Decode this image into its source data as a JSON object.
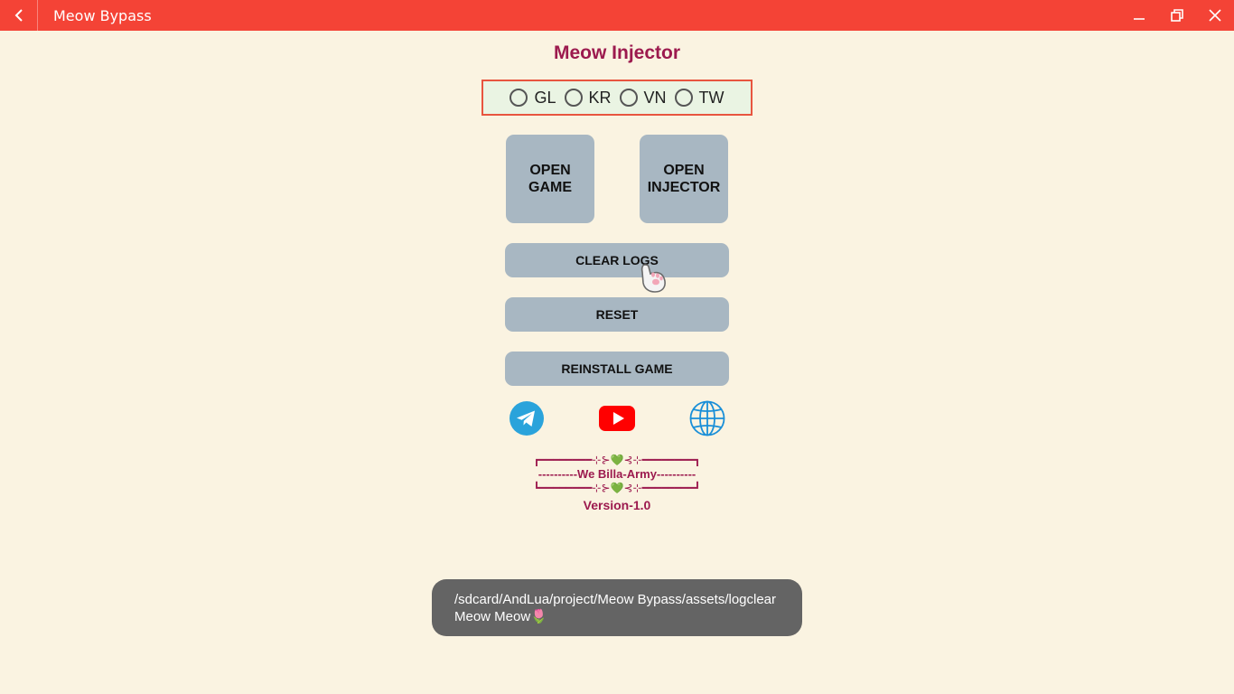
{
  "window": {
    "title": "Meow Bypass",
    "titlebar_color": "#f44336",
    "back_icon": "chevron-left-icon",
    "controls": [
      "minimize-icon",
      "restore-icon",
      "close-icon"
    ]
  },
  "main": {
    "heading": "Meow Injector",
    "regions": [
      {
        "label": "GL",
        "selected": false
      },
      {
        "label": "KR",
        "selected": false
      },
      {
        "label": "VN",
        "selected": false
      },
      {
        "label": "TW",
        "selected": false
      }
    ],
    "open_game": {
      "line1": "OPEN",
      "line2": "GAME"
    },
    "open_injector": {
      "line1": "OPEN",
      "line2": "INJECTOR"
    },
    "clear_logs": "CLEAR LOGS",
    "reset": "RESET",
    "reinstall": "REINSTALL GAME",
    "social": [
      "telegram-icon",
      "youtube-icon",
      "globe-icon"
    ],
    "banner": {
      "top": "┏━━━━━━━━⊹⊱💚⊰⊹━━━━━━━━┓",
      "middle": "----------We Billa-Army----------",
      "bottom": "┗━━━━━━━━⊹⊱💚⊰⊹━━━━━━━━┛"
    },
    "version": "Version-1.0",
    "accent_color": "#9c1a4e",
    "button_color": "#a8b7c2"
  },
  "toast": {
    "line1": "/sdcard/AndLua/project/Meow Bypass/assets/logclear",
    "line2": "Meow Meow",
    "emoji": "🌷"
  }
}
